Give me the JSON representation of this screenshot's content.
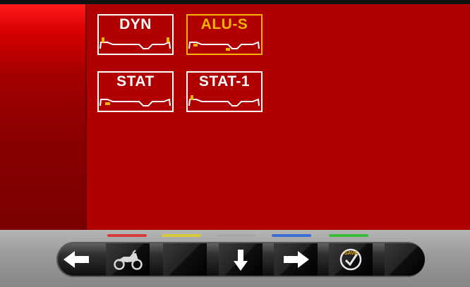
{
  "modes": [
    {
      "label": "DYN",
      "selected": false
    },
    {
      "label": "ALU-S",
      "selected": true
    },
    {
      "label": "STAT",
      "selected": false
    },
    {
      "label": "STAT-1",
      "selected": false
    }
  ],
  "toolbar": {
    "indicator_colors": [
      "#d63b3b",
      "#d6c93b",
      "#a8a8a8",
      "#3b6fd6",
      "#3bbf3b"
    ],
    "buttons": [
      {
        "icon": "arrow-left-icon"
      },
      {
        "icon": "motorbike-icon"
      },
      {
        "icon": "blank"
      },
      {
        "icon": "arrow-down-icon"
      },
      {
        "icon": "arrow-right-icon"
      },
      {
        "icon": "save-check-icon",
        "label": "SAVE"
      },
      {
        "icon": "blank"
      }
    ]
  },
  "colors": {
    "background": "#b00000",
    "selected_accent": "#f4b400",
    "weight_marker": "#f4b400"
  }
}
